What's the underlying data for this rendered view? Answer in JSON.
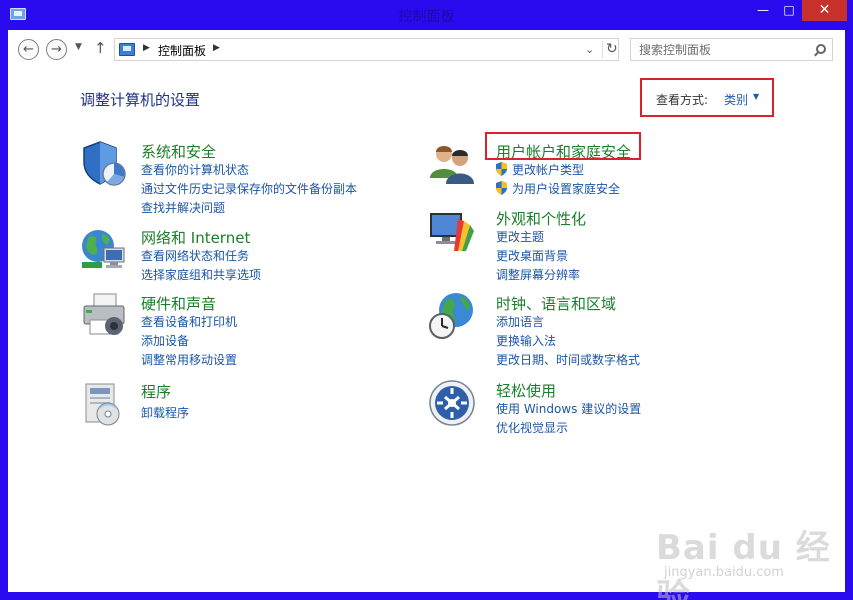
{
  "window": {
    "title": "控制面板",
    "min": "—",
    "max": "□",
    "close": "✕"
  },
  "nav": {
    "back_icon": "arrow-left-icon",
    "forward_icon": "arrow-right-icon",
    "up_icon": "arrow-up-icon",
    "address_path": "控制面板",
    "search_placeholder": "搜索控制面板"
  },
  "header": {
    "title": "调整计算机的设置",
    "view_by_label": "查看方式:",
    "view_by_value": "类别"
  },
  "categories": [
    {
      "icon": "shield-icon",
      "title": "系统和安全",
      "links": [
        "查看你的计算机状态",
        "通过文件历史记录保存你的文件备份副本",
        "查找并解决问题"
      ]
    },
    {
      "icon": "network-icon",
      "title": "网络和 Internet",
      "links": [
        "查看网络状态和任务",
        "选择家庭组和共享选项"
      ]
    },
    {
      "icon": "printer-icon",
      "title": "硬件和声音",
      "links": [
        "查看设备和打印机",
        "添加设备",
        "调整常用移动设置"
      ]
    },
    {
      "icon": "programs-icon",
      "title": "程序",
      "links": [
        "卸载程序"
      ]
    },
    {
      "icon": "users-icon",
      "title": "用户帐户和家庭安全",
      "links": [
        "更改帐户类型",
        "为用户设置家庭安全"
      ]
    },
    {
      "icon": "personalization-icon",
      "title": "外观和个性化",
      "links": [
        "更改主题",
        "更改桌面背景",
        "调整屏幕分辨率"
      ]
    },
    {
      "icon": "clock-globe-icon",
      "title": "时钟、语言和区域",
      "links": [
        "添加语言",
        "更换输入法",
        "更改日期、时间或数字格式"
      ]
    },
    {
      "icon": "ease-of-access-icon",
      "title": "轻松使用",
      "links": [
        "使用 Windows 建议的设置",
        "优化视觉显示"
      ]
    }
  ],
  "watermark": {
    "brand": "Bai du 经验",
    "url": "jingyan.baidu.com"
  },
  "colors": {
    "frame": "#2a0bf0",
    "title_green": "#1b7f2a",
    "link_blue": "#1b56a6",
    "highlight_red": "#d9222a",
    "close_red": "#c7302b"
  }
}
